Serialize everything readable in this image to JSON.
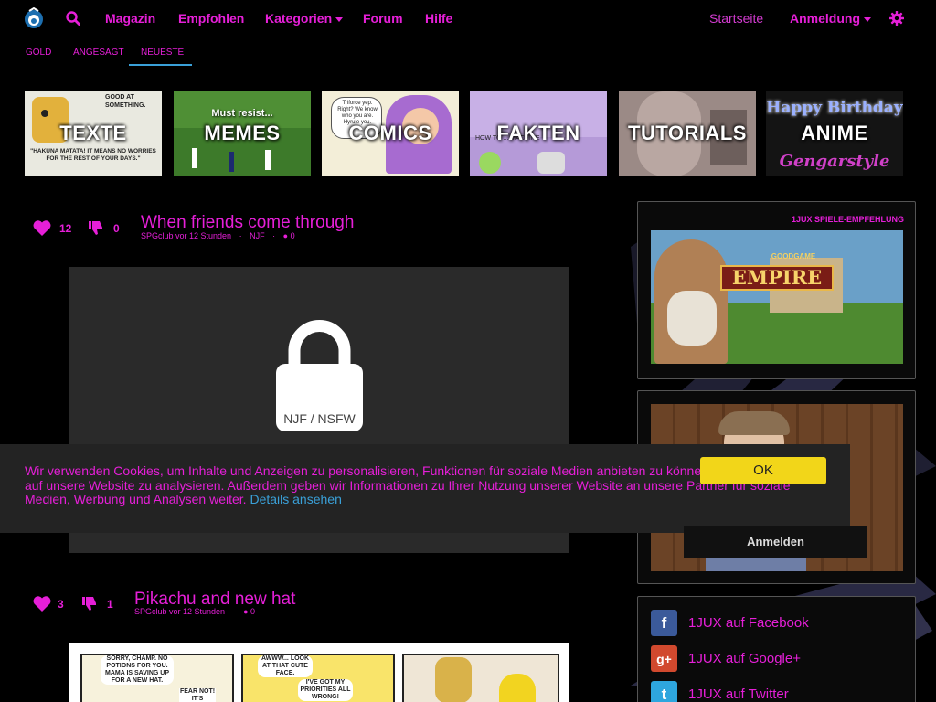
{
  "nav": {
    "magazin": "Magazin",
    "empfohlen": "Empfohlen",
    "kategorien": "Kategorien",
    "forum": "Forum",
    "hilfe": "Hilfe",
    "startseite": "Startseite",
    "anmeldung": "Anmeldung"
  },
  "subnav": {
    "gold": "GOLD",
    "angesagt": "ANGESAGT",
    "neueste": "NEUESTE"
  },
  "categories": [
    "TEXTE",
    "MEMES",
    "COMICS",
    "FAKTEN",
    "TUTORIALS",
    "ANIME"
  ],
  "tile_text": {
    "texte_top": "GOOD AT SOMETHING.",
    "texte_bottom": "\"HAKUNA MATATA! IT MEANS NO WORRIES FOR THE REST OF YOUR DAYS.\"",
    "memes_top": "Must resist...",
    "comics_bubble": "Triforce yep. Right? We know who you are. Hyrule you.",
    "fakten_small": "HOW TO ... MACHINE",
    "anime_top": "Happy Birthday",
    "anime_bottom": "Gengarstyle"
  },
  "posts": [
    {
      "likes": "12",
      "dislikes": "0",
      "title": "When friends come through",
      "author": "SPGclub vor 12 Stunden",
      "category": "NJF",
      "comments": "0",
      "lock_label": "NJF / NSFW"
    },
    {
      "likes": "3",
      "dislikes": "1",
      "title": "Pikachu and new hat",
      "author": "SPGclub vor 12 Stunden",
      "comments": "0"
    }
  ],
  "comic_text": {
    "panel1": "SORRY, CHAMP. NO POTIONS FOR YOU. MAMA IS SAVING UP FOR A NEW HAT.",
    "panel1b": "FEAR NOT! IT'S",
    "panel2": "AWWW... LOOK AT THAT CUTE FACE.",
    "panel2b": "I'VE GOT MY PRIORITIES ALL WRONG!"
  },
  "sidebar": {
    "games_title": "1JUX SPIELE-EMPFEHLUNG",
    "game_logo_top": "GOODGAME",
    "game_logo": "EMPIRE",
    "social": [
      "1JUX auf Facebook",
      "1JUX auf Google+",
      "1JUX auf Twitter"
    ]
  },
  "cookie": {
    "text": "Wir verwenden Cookies, um Inhalte und Anzeigen zu personalisieren, Funktionen für soziale Medien anbieten zu können und die Zugriffe auf unsere Website zu analysieren. Außerdem geben wir Informationen zu Ihrer Nutzung unserer Website an unsere Partner für soziale Medien, Werbung und Analysen weiter.",
    "link": "Details ansehen",
    "ok": "OK"
  },
  "login_popup": "Anmelden",
  "colors": {
    "accent": "#e61fd8",
    "link": "#3aa0d8",
    "ok_button": "#f2d619",
    "background": "#000000"
  }
}
